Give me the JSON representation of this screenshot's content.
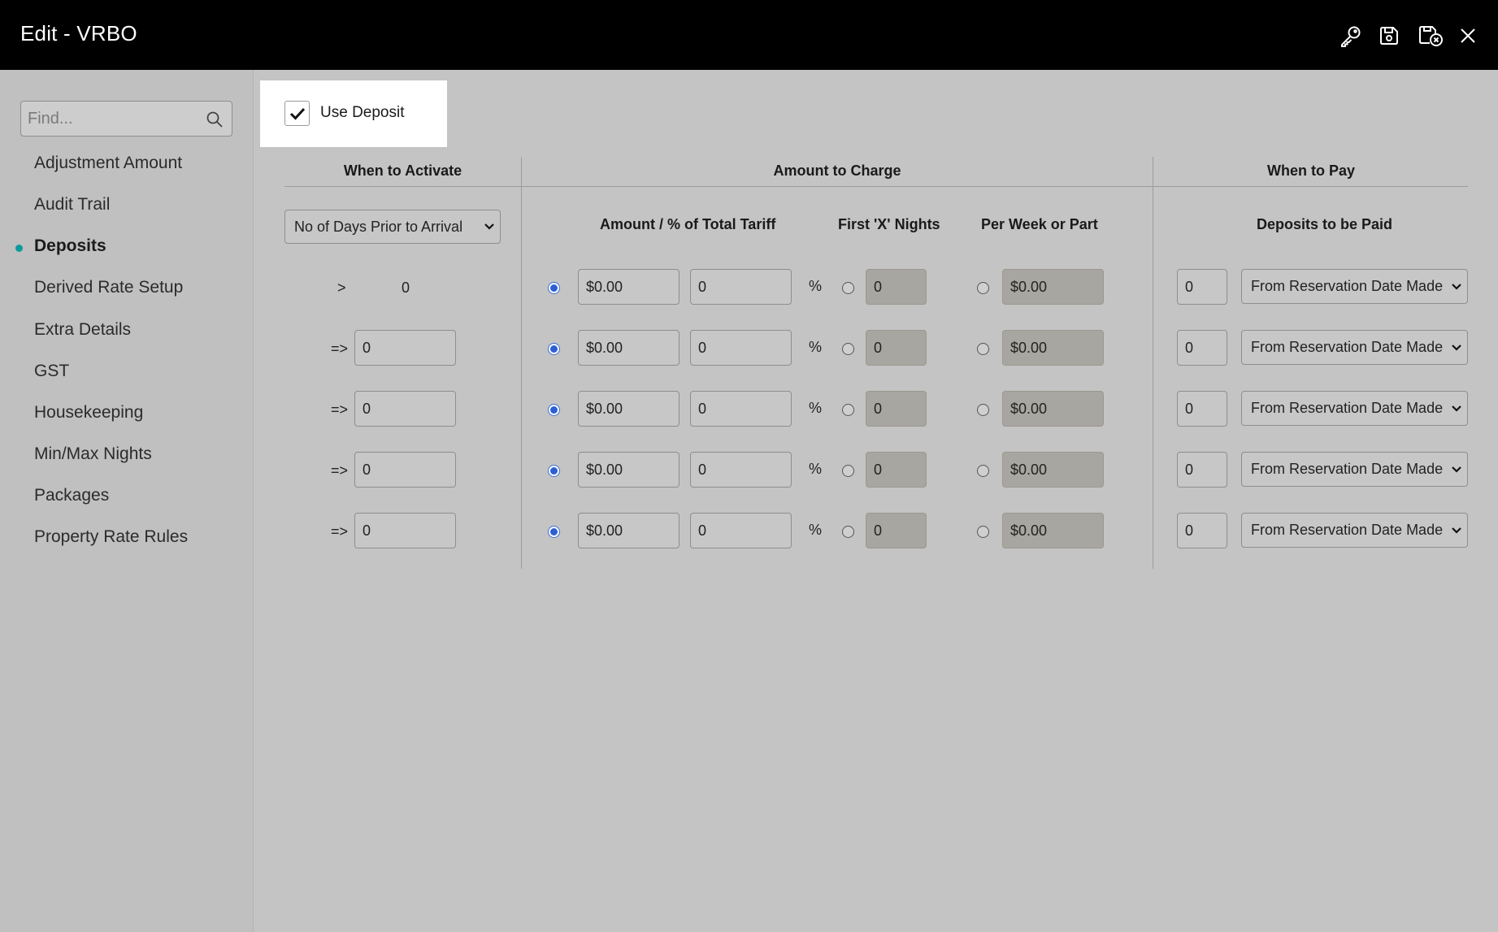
{
  "header": {
    "title": "Edit - VRBO"
  },
  "sidebar": {
    "search_placeholder": "Find...",
    "items": [
      {
        "label": "Adjustment Amount"
      },
      {
        "label": "Audit Trail"
      },
      {
        "label": "Deposits"
      },
      {
        "label": "Derived Rate Setup"
      },
      {
        "label": "Extra Details"
      },
      {
        "label": "GST"
      },
      {
        "label": "Housekeeping"
      },
      {
        "label": "Min/Max Nights"
      },
      {
        "label": "Packages"
      },
      {
        "label": "Property Rate Rules"
      }
    ],
    "active_item": "Deposits"
  },
  "use_deposit": {
    "label": "Use Deposit",
    "checked": true
  },
  "columns": {
    "when_to_activate": "When to Activate",
    "amount_to_charge": "Amount to Charge",
    "when_to_pay": "When to Pay",
    "amount_pct": "Amount / % of Total Tariff",
    "first_x_nights": "First 'X' Nights",
    "per_week": "Per Week or Part",
    "deposits_to_be_paid": "Deposits to be Paid"
  },
  "activate_select": "No of Days Prior to Arrival",
  "rows": [
    {
      "op": ">",
      "days": "0",
      "amount": "$0.00",
      "pct": "0",
      "pct_sign": "%",
      "nights": "0",
      "per_week": "$0.00",
      "pay_days": "0",
      "pay_from": "From Reservation Date Made"
    },
    {
      "op": "=>",
      "days": "0",
      "amount": "$0.00",
      "pct": "0",
      "pct_sign": "%",
      "nights": "0",
      "per_week": "$0.00",
      "pay_days": "0",
      "pay_from": "From Reservation Date Made"
    },
    {
      "op": "=>",
      "days": "0",
      "amount": "$0.00",
      "pct": "0",
      "pct_sign": "%",
      "nights": "0",
      "per_week": "$0.00",
      "pay_days": "0",
      "pay_from": "From Reservation Date Made"
    },
    {
      "op": "=>",
      "days": "0",
      "amount": "$0.00",
      "pct": "0",
      "pct_sign": "%",
      "nights": "0",
      "per_week": "$0.00",
      "pay_days": "0",
      "pay_from": "From Reservation Date Made"
    },
    {
      "op": "=>",
      "days": "0",
      "amount": "$0.00",
      "pct": "0",
      "pct_sign": "%",
      "nights": "0",
      "per_week": "$0.00",
      "pay_days": "0",
      "pay_from": "From Reservation Date Made"
    }
  ],
  "colors": {
    "header_bg": "#000000",
    "active_dot": "#0e9a9a",
    "radio_selected": "#2d5fd4"
  }
}
